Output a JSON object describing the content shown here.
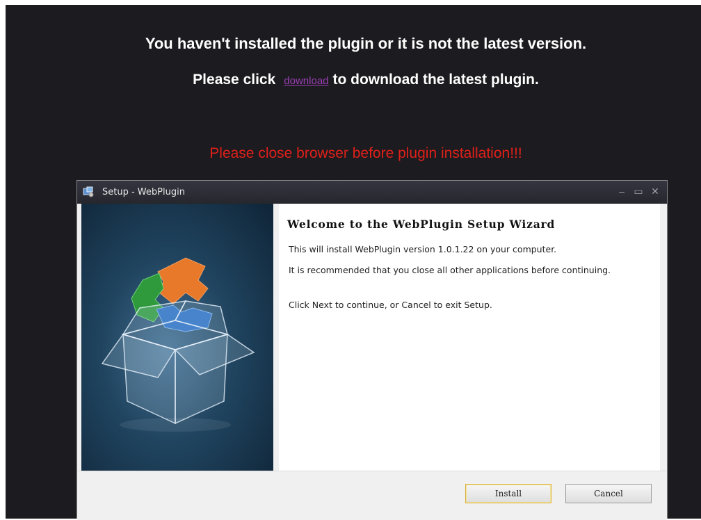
{
  "page": {
    "message_line1": "You haven't installed the plugin or it is not the latest version.",
    "message_line2_before": "Please click",
    "download_link": "download",
    "message_line2_after": "to download the latest plugin.",
    "warning": "Please close browser before plugin installation!!!"
  },
  "dialog": {
    "title": "Setup - WebPlugin",
    "controls": {
      "minimize": "–",
      "maximize": "▭",
      "close": "✕"
    },
    "heading": "Welcome to the WebPlugin Setup Wizard",
    "line1": "This will install WebPlugin version 1.0.1.22 on your computer.",
    "line2": "It is recommended that you close all other applications before continuing.",
    "line3": "Click Next to continue, or Cancel to exit Setup.",
    "install_label": "Install",
    "cancel_label": "Cancel"
  },
  "colors": {
    "background": "#1c1b1f",
    "link": "#9b3fb5",
    "warning": "#e0201a"
  },
  "icons": [
    "setup-app-icon",
    "puzzle-box-illustration"
  ]
}
